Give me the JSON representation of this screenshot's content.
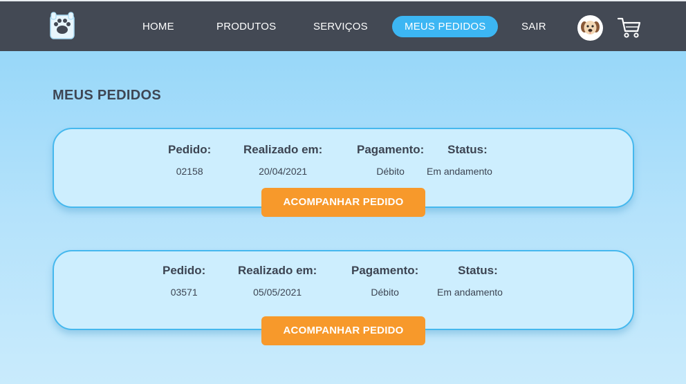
{
  "nav": {
    "links": [
      {
        "label": "HOME"
      },
      {
        "label": "PRODUTOS"
      },
      {
        "label": "SERVIÇOS"
      },
      {
        "label": "MEUS PEDIDOS",
        "active": true
      },
      {
        "label": "SAIR"
      }
    ],
    "logo_icon": "paw-icon",
    "avatar_icon": "dog-avatar-icon",
    "cart_icon": "cart-icon"
  },
  "page": {
    "title": "MEUS PEDIDOS"
  },
  "labels": {
    "pedido": "Pedido:",
    "realizado": "Realizado em:",
    "pagamento": "Pagamento:",
    "status": "Status:",
    "track_button": "ACOMPANHAR PEDIDO"
  },
  "orders": [
    {
      "pedido": "02158",
      "realizado": "20/04/2021",
      "pagamento": "Débito",
      "status": "Em andamento"
    },
    {
      "pedido": "03571",
      "realizado": "05/05/2021",
      "pagamento": "Débito",
      "status": "Em andamento"
    }
  ],
  "colors": {
    "topbar": "#434954",
    "active_nav": "#3cb6f3",
    "card_bg": "#cdeefe",
    "card_border": "#45b8ee",
    "button": "#f7992b",
    "text": "#3c4452"
  }
}
